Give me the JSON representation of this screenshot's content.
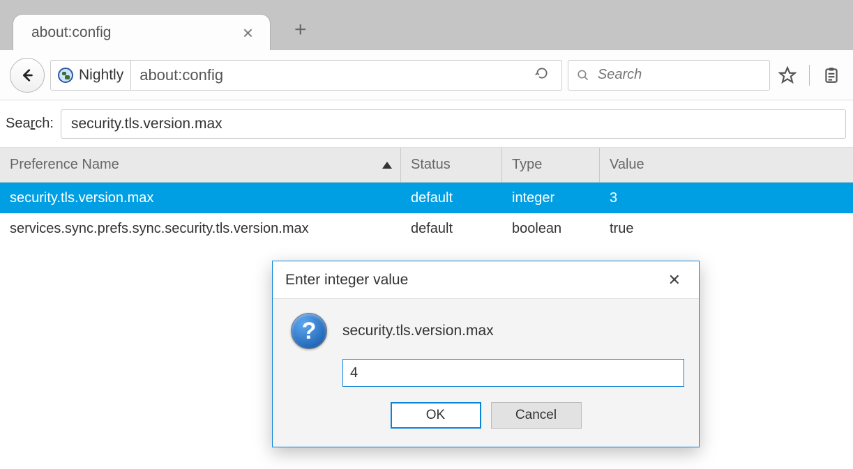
{
  "tabs": {
    "active_title": "about:config"
  },
  "navbar": {
    "identity_label": "Nightly",
    "url": "about:config",
    "search_placeholder": "Search"
  },
  "filter": {
    "label_prefix_char": "r",
    "label_rest": "ch:",
    "label_prefix": "Sea",
    "value": "security.tls.version.max"
  },
  "table": {
    "cols": {
      "pref": "Preference Name",
      "status": "Status",
      "type": "Type",
      "value": "Value"
    },
    "rows": [
      {
        "pref": "security.tls.version.max",
        "status": "default",
        "type": "integer",
        "value": "3",
        "selected": true
      },
      {
        "pref": "services.sync.prefs.sync.security.tls.version.max",
        "status": "default",
        "type": "boolean",
        "value": "true",
        "selected": false
      }
    ]
  },
  "modal": {
    "title": "Enter integer value",
    "pref_name": "security.tls.version.max",
    "input_value": "4",
    "ok_label": "OK",
    "cancel_label": "Cancel"
  }
}
